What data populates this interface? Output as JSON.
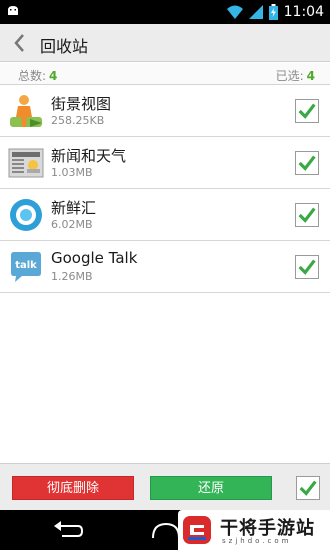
{
  "status_bar": {
    "time": "11:04"
  },
  "title_bar": {
    "title": "回收站"
  },
  "summary": {
    "total_label": "总数:",
    "total_value": "4",
    "selected_label": "已选:",
    "selected_value": "4"
  },
  "apps": [
    {
      "name": "街景视图",
      "size": "258.25KB",
      "icon": "street-view-icon",
      "checked": true
    },
    {
      "name": "新闻和天气",
      "size": "1.03MB",
      "icon": "news-weather-icon",
      "checked": true
    },
    {
      "name": "新鲜汇",
      "size": "6.02MB",
      "icon": "currents-icon",
      "checked": true
    },
    {
      "name": "Google Talk",
      "size": "1.26MB",
      "icon": "google-talk-icon",
      "checked": true
    }
  ],
  "bottom_bar": {
    "delete_label": "彻底删除",
    "restore_label": "还原",
    "select_all_checked": true
  },
  "watermark": {
    "text": "干将手游站",
    "sub": "szjhdo.com"
  },
  "colors": {
    "accent_green": "#4caa2a",
    "delete_red": "#e03434",
    "restore_green": "#32b457",
    "check_green": "#3aa845"
  }
}
